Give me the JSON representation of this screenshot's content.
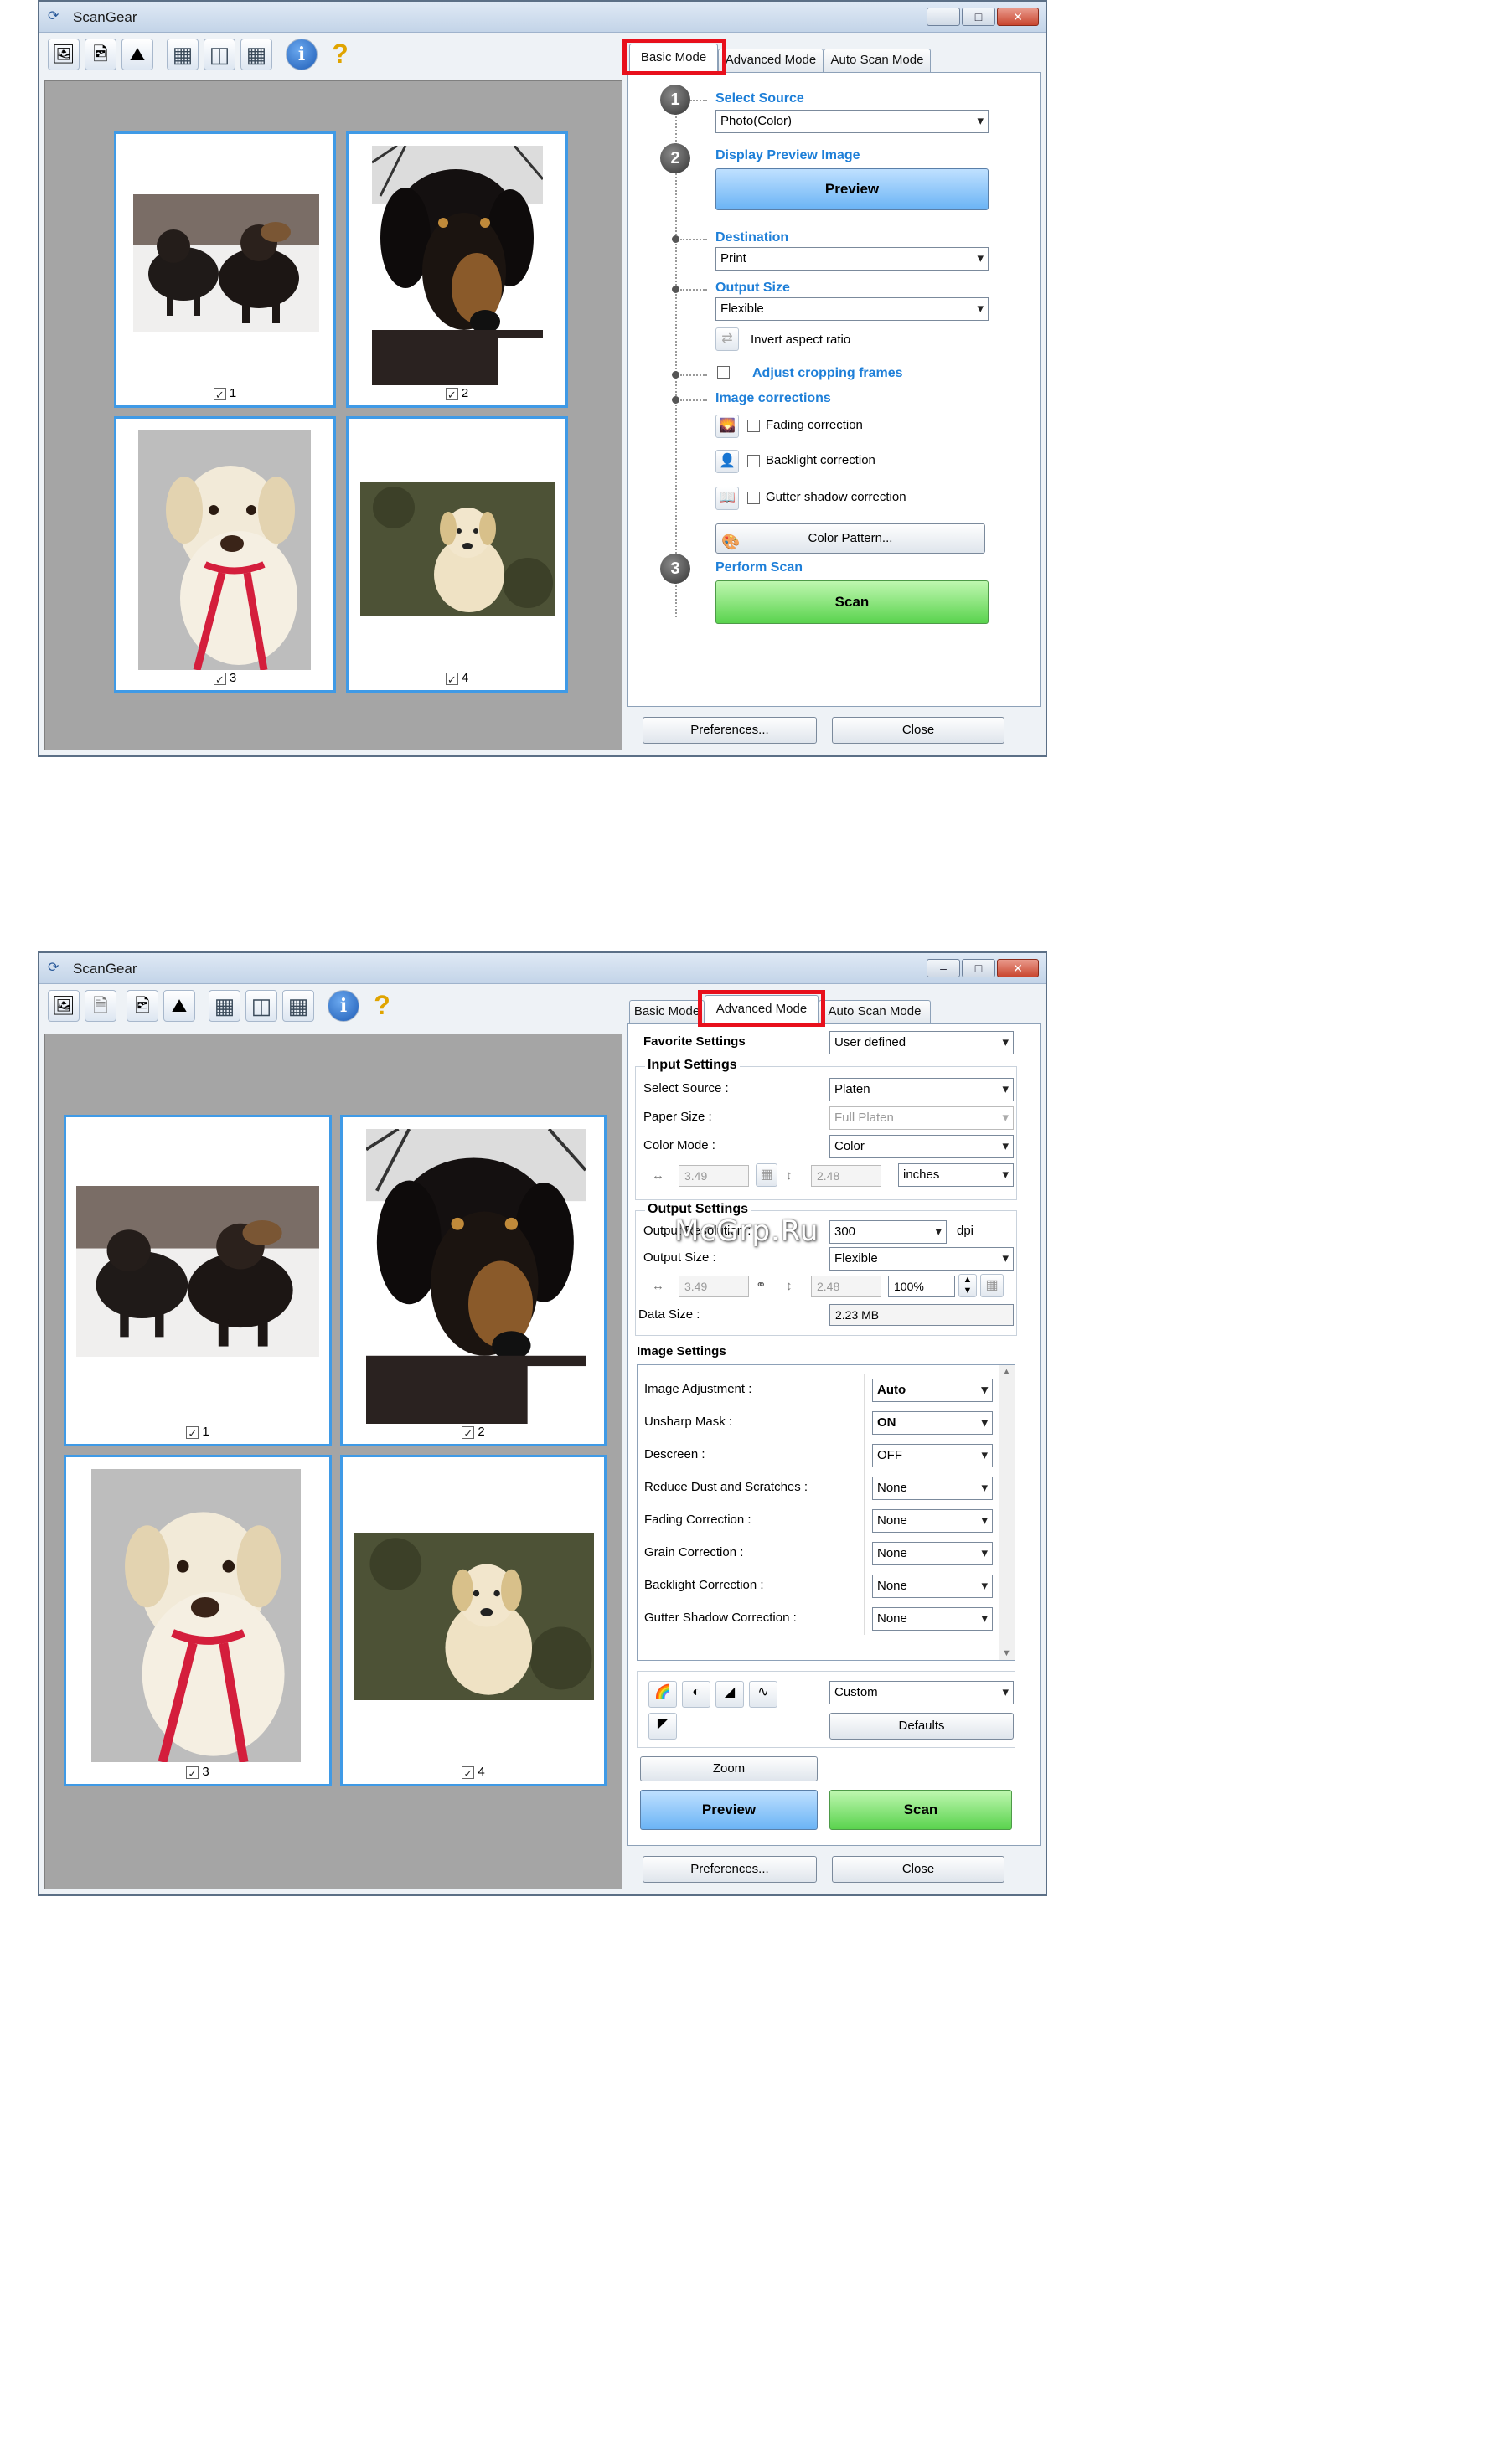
{
  "window1": {
    "title": "ScanGear",
    "tabs": [
      "Basic Mode",
      "Advanced Mode",
      "Auto Scan Mode"
    ],
    "active_tab": "Basic Mode",
    "thumbnails": [
      {
        "label": "1",
        "checked": true,
        "subject": "two small dark dogs on white floor"
      },
      {
        "label": "2",
        "checked": true,
        "subject": "black dachshund portrait"
      },
      {
        "label": "3",
        "checked": true,
        "subject": "yellow labrador with red leash"
      },
      {
        "label": "4",
        "checked": true,
        "subject": "white dog on grass"
      }
    ],
    "steps": {
      "select_source": {
        "num": "1",
        "title": "Select Source",
        "value": "Photo(Color)"
      },
      "display_preview": {
        "num": "2",
        "title": "Display Preview Image",
        "button": "Preview"
      },
      "destination": {
        "title": "Destination",
        "value": "Print"
      },
      "output_size": {
        "title": "Output Size",
        "value": "Flexible",
        "invert": "Invert aspect ratio"
      },
      "adjust_frames": {
        "title": "Adjust cropping frames"
      },
      "image_corrections": {
        "title": "Image corrections",
        "fading": "Fading correction",
        "backlight": "Backlight correction",
        "gutter": "Gutter shadow correction",
        "color_pattern": "Color Pattern..."
      },
      "perform_scan": {
        "num": "3",
        "title": "Perform Scan",
        "button": "Scan"
      }
    },
    "footer": {
      "preferences": "Preferences...",
      "close": "Close"
    }
  },
  "window2": {
    "title": "ScanGear",
    "tabs": [
      "Basic Mode",
      "Advanced Mode",
      "Auto Scan Mode"
    ],
    "active_tab": "Advanced Mode",
    "thumbnails": [
      {
        "label": "1",
        "checked": true
      },
      {
        "label": "2",
        "checked": true
      },
      {
        "label": "3",
        "checked": true
      },
      {
        "label": "4",
        "checked": true
      }
    ],
    "favorite": {
      "label": "Favorite Settings",
      "value": "User defined"
    },
    "input": {
      "title": "Input Settings",
      "select_source_label": "Select Source :",
      "select_source": "Platen",
      "paper_size_label": "Paper Size :",
      "paper_size": "Full Platen",
      "color_mode_label": "Color Mode :",
      "color_mode": "Color",
      "width": "3.49",
      "height": "2.48",
      "units": "inches"
    },
    "output": {
      "title": "Output Settings",
      "resolution_label": "Output Resolution :",
      "resolution": "300",
      "dpi": "dpi",
      "size_label": "Output Size :",
      "size": "Flexible",
      "width": "3.49",
      "height": "2.48",
      "scale": "100%",
      "data_size_label": "Data Size :",
      "data_size": "2.23 MB"
    },
    "image_settings": {
      "title": "Image Settings",
      "rows": [
        {
          "label": "Image Adjustment :",
          "value": "Auto",
          "bold": true
        },
        {
          "label": "Unsharp Mask :",
          "value": "ON",
          "bold": true
        },
        {
          "label": "Descreen :",
          "value": "OFF",
          "bold": false
        },
        {
          "label": "Reduce Dust and Scratches :",
          "value": "None",
          "bold": false
        },
        {
          "label": "Fading Correction :",
          "value": "None",
          "bold": false
        },
        {
          "label": "Grain Correction :",
          "value": "None",
          "bold": false
        },
        {
          "label": "Backlight Correction :",
          "value": "None",
          "bold": false
        },
        {
          "label": "Gutter Shadow Correction :",
          "value": "None",
          "bold": false
        }
      ]
    },
    "tools": {
      "preset": "Custom",
      "defaults": "Defaults",
      "zoom": "Zoom",
      "preview": "Preview",
      "scan": "Scan"
    },
    "footer": {
      "preferences": "Preferences...",
      "close": "Close"
    }
  },
  "watermark": "McGrp.Ru",
  "colors": {
    "highlight": "#e8101c",
    "step_title": "#1e7fd8",
    "selection": "#3f9ae6",
    "scan_green": "#5ad34e",
    "preview_blue": "#6bb4f5"
  }
}
